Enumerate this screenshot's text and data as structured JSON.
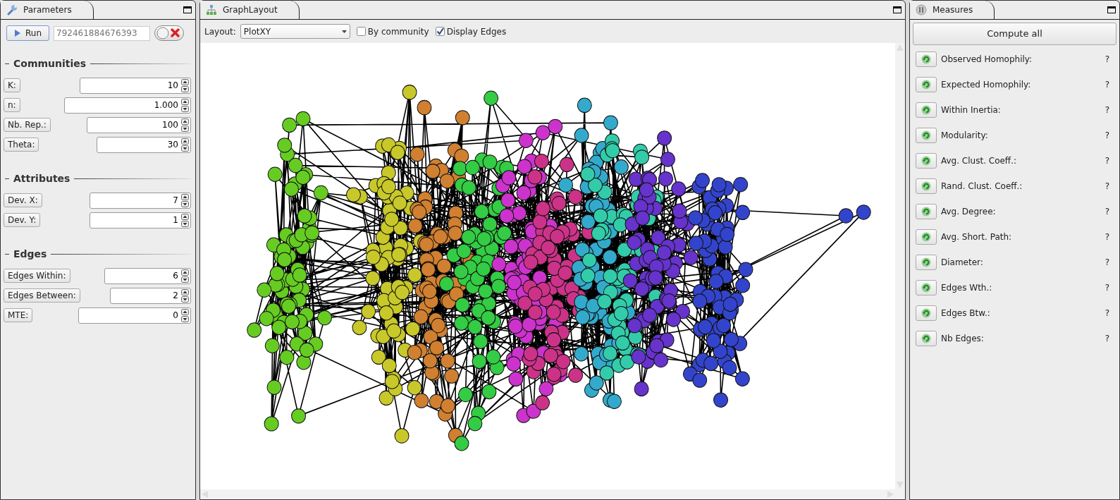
{
  "parameters_panel": {
    "title": "Parameters",
    "run_button": "Run",
    "seed": {
      "placeholder": "792461884676393"
    },
    "toggle": {
      "on": false
    },
    "sections": [
      {
        "title": "Communities",
        "fields": [
          {
            "label": "K:",
            "value": "10"
          },
          {
            "label": "n:",
            "value": "1.000"
          },
          {
            "label": "Nb. Rep.:",
            "value": "100"
          },
          {
            "label": "Theta:",
            "value": "30"
          }
        ]
      },
      {
        "title": "Attributes",
        "fields": [
          {
            "label": "Dev. X:",
            "value": "7"
          },
          {
            "label": "Dev. Y:",
            "value": "1"
          }
        ]
      },
      {
        "title": "Edges",
        "fields": [
          {
            "label": "Edges Within:",
            "value": "6"
          },
          {
            "label": "Edges Between:",
            "value": "2"
          },
          {
            "label": "MTE:",
            "value": "0"
          }
        ]
      }
    ]
  },
  "graph_panel": {
    "title": "GraphLayout",
    "layout_label": "Layout:",
    "layout_value": "PlotXY",
    "checkboxes": [
      {
        "label": "By community",
        "checked": false
      },
      {
        "label": "Display Edges",
        "checked": true
      }
    ]
  },
  "measures_panel": {
    "title": "Measures",
    "compute_all": "Compute all",
    "measures": [
      {
        "label": "Observed Homophily:",
        "value": "?"
      },
      {
        "label": "Expected Homophily:",
        "value": "?"
      },
      {
        "label": "Within Inertia:",
        "value": "?"
      },
      {
        "label": "Modularity:",
        "value": "?"
      },
      {
        "label": "Avg. Clust. Coeff.:",
        "value": "?"
      },
      {
        "label": "Rand. Clust. Coeff.:",
        "value": "?"
      },
      {
        "label": "Avg. Degree:",
        "value": "?"
      },
      {
        "label": "Avg. Short. Path:",
        "value": "?"
      },
      {
        "label": "Diameter:",
        "value": "?"
      },
      {
        "label": "Edges Wth.:",
        "value": "?"
      },
      {
        "label": "Edges Btw.:",
        "value": "?"
      },
      {
        "label": "Nb Edges:",
        "value": "?"
      }
    ]
  }
}
